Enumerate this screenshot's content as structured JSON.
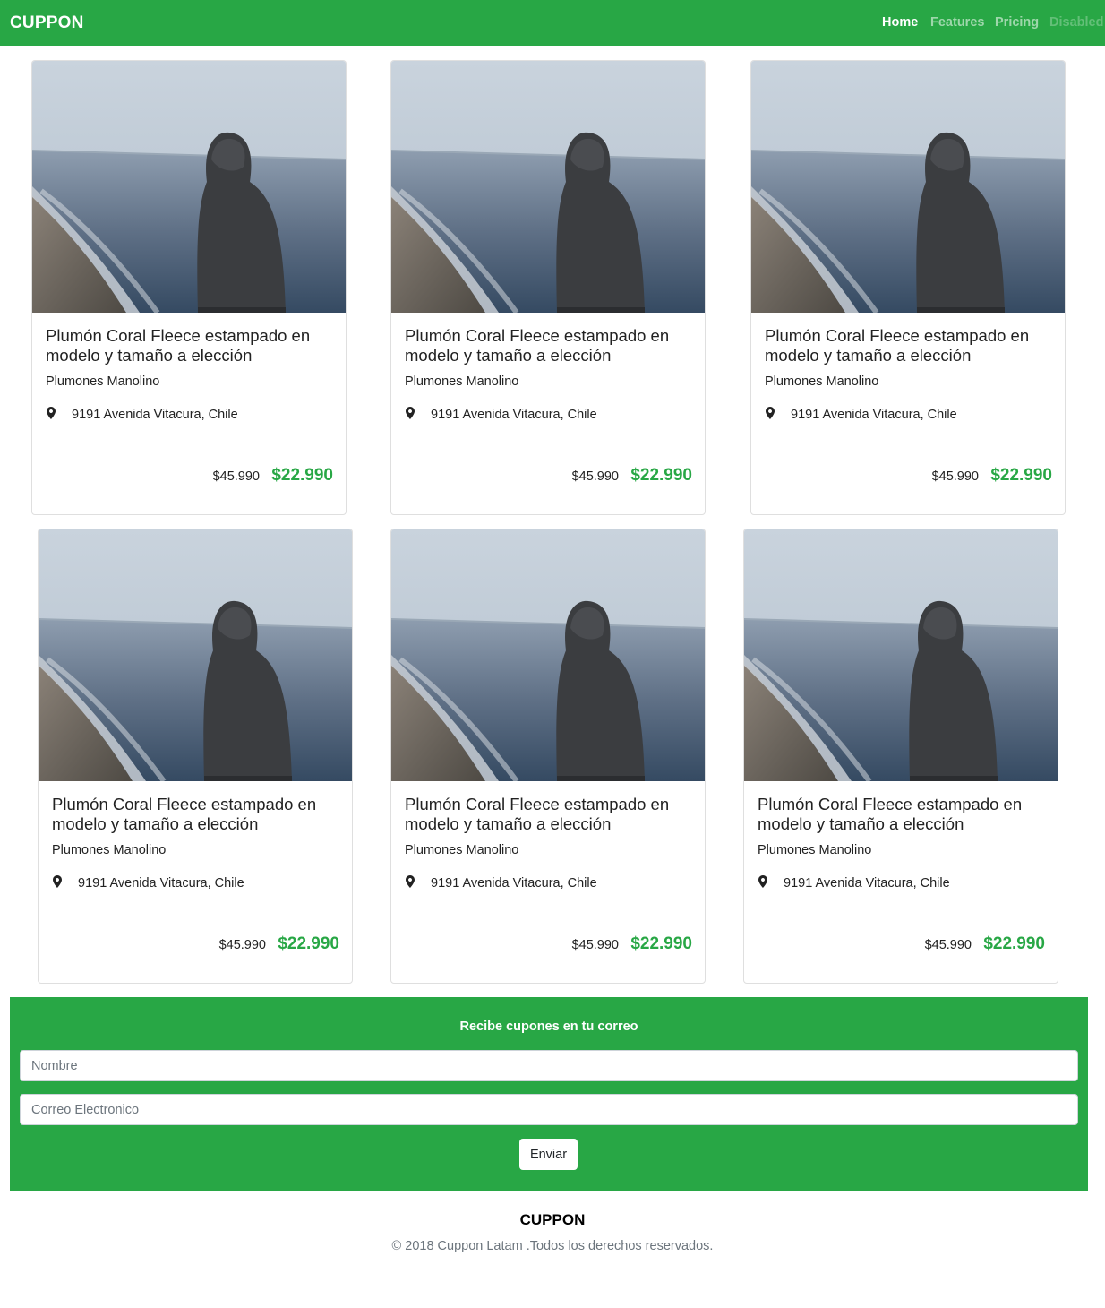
{
  "navbar": {
    "brand": "CUPPON",
    "items": [
      {
        "label": "Home"
      },
      {
        "label": "Features"
      },
      {
        "label": "Pricing"
      },
      {
        "label": "Disabled"
      }
    ]
  },
  "cards": [
    {
      "title": "Plumón Coral Fleece estampado en modelo y tamaño a elección",
      "shop": "Plumones Manolino",
      "address": "9191 Avenida Vitacura, Chile",
      "old_price": "$45.990",
      "new_price": "$22.990"
    },
    {
      "title": "Plumón Coral Fleece estampado en modelo y tamaño a elección",
      "shop": "Plumones Manolino",
      "address": "9191 Avenida Vitacura, Chile",
      "old_price": "$45.990",
      "new_price": "$22.990"
    },
    {
      "title": "Plumón Coral Fleece estampado en modelo y tamaño a elección",
      "shop": "Plumones Manolino",
      "address": "9191 Avenida Vitacura, Chile",
      "old_price": "$45.990",
      "new_price": "$22.990"
    },
    {
      "title": "Plumón Coral Fleece estampado en modelo y tamaño a elección",
      "shop": "Plumones Manolino",
      "address": "9191 Avenida Vitacura, Chile",
      "old_price": "$45.990",
      "new_price": "$22.990"
    },
    {
      "title": "Plumón Coral Fleece estampado en modelo y tamaño a elección",
      "shop": "Plumones Manolino",
      "address": "9191 Avenida Vitacura, Chile",
      "old_price": "$45.990",
      "new_price": "$22.990"
    },
    {
      "title": "Plumón Coral Fleece estampado en modelo y tamaño a elección",
      "shop": "Plumones Manolino",
      "address": "9191 Avenida Vitacura, Chile",
      "old_price": "$45.990",
      "new_price": "$22.990"
    }
  ],
  "subscribe": {
    "title": "Recibe cupones en tu correo",
    "name_placeholder": "Nombre",
    "email_placeholder": "Correo Electronico",
    "submit_label": "Enviar"
  },
  "footer": {
    "brand": "CUPPON",
    "copyright": "© 2018 Cuppon Latam .Todos los derechos reservados."
  },
  "colors": {
    "brand_green": "#28a745"
  },
  "icons": {
    "location": "map-marker-icon"
  }
}
